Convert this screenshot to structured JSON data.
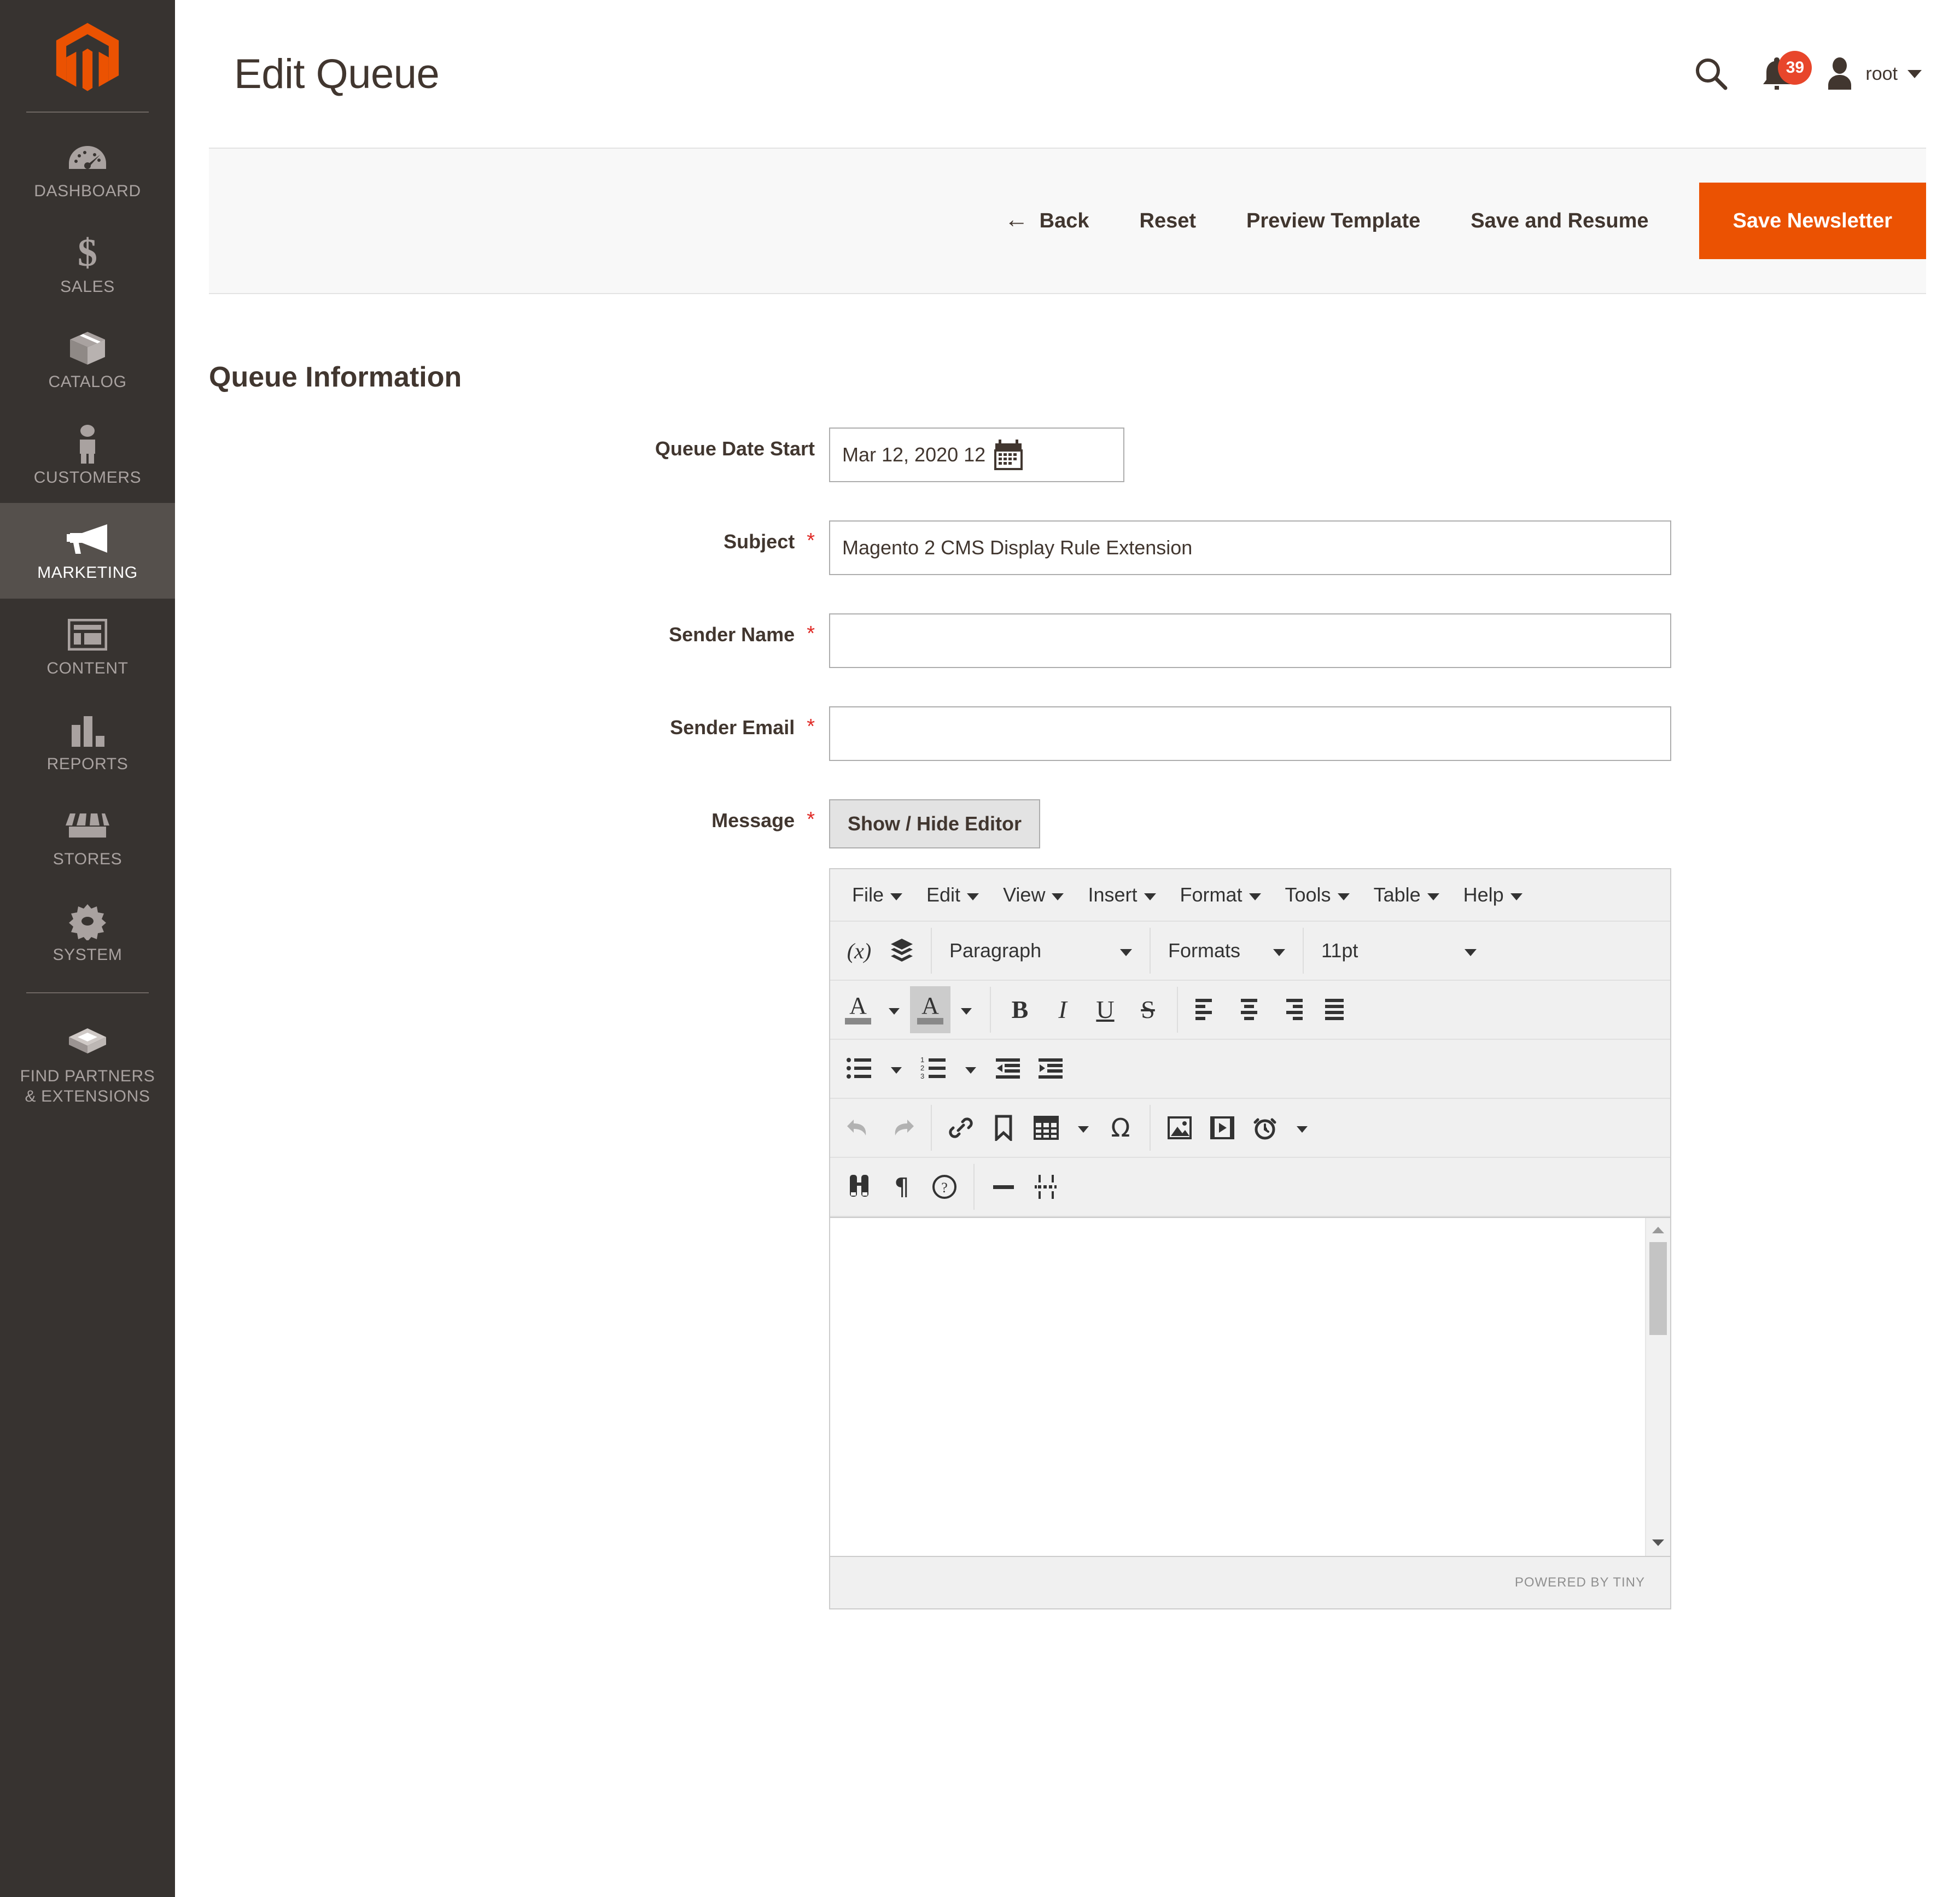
{
  "sidebar": {
    "logo_name": "magento-logo",
    "items": [
      {
        "label": "DASHBOARD",
        "icon": "dashboard-gauge-icon",
        "active": false
      },
      {
        "label": "SALES",
        "icon": "dollar-sign-icon",
        "active": false
      },
      {
        "label": "CATALOG",
        "icon": "box-icon",
        "active": false
      },
      {
        "label": "CUSTOMERS",
        "icon": "person-icon",
        "active": false
      },
      {
        "label": "MARKETING",
        "icon": "megaphone-icon",
        "active": true
      },
      {
        "label": "CONTENT",
        "icon": "layout-window-icon",
        "active": false
      },
      {
        "label": "REPORTS",
        "icon": "bar-chart-icon",
        "active": false
      },
      {
        "label": "STORES",
        "icon": "storefront-icon",
        "active": false
      },
      {
        "label": "SYSTEM",
        "icon": "gear-icon",
        "active": false
      },
      {
        "label": "FIND PARTNERS\n& EXTENSIONS",
        "icon": "extension-box-icon",
        "active": false
      }
    ]
  },
  "header": {
    "title": "Edit Queue",
    "search_icon": "search-icon",
    "notifications_icon": "bell-icon",
    "notifications_count": "39",
    "user_icon": "user-avatar-icon",
    "user_name": "root"
  },
  "actions": {
    "back": "Back",
    "back_arrow": "←",
    "reset": "Reset",
    "preview_template": "Preview Template",
    "save_and_resume": "Save and Resume",
    "save_newsletter": "Save Newsletter",
    "primary_color": "#eb5202"
  },
  "form": {
    "section_title": "Queue Information",
    "queue_date_start": {
      "label": "Queue Date Start",
      "value": "Mar 12, 2020 12",
      "calendar_icon": "calendar-icon",
      "required": false
    },
    "subject": {
      "label": "Subject",
      "value": "Magento 2 CMS Display Rule Extension",
      "placeholder": "",
      "required": true
    },
    "sender_name": {
      "label": "Sender Name",
      "value": "",
      "placeholder": "",
      "required": true
    },
    "sender_email": {
      "label": "Sender Email",
      "value": "",
      "placeholder": "",
      "required": true
    },
    "message": {
      "label": "Message",
      "toggle_editor_label": "Show / Hide Editor",
      "required": true
    },
    "required_marker": "*"
  },
  "editor": {
    "menubar": [
      {
        "label": "File"
      },
      {
        "label": "Edit"
      },
      {
        "label": "View"
      },
      {
        "label": "Insert"
      },
      {
        "label": "Format"
      },
      {
        "label": "Tools"
      },
      {
        "label": "Table"
      },
      {
        "label": "Help"
      }
    ],
    "block_format": "Paragraph",
    "formats_label": "Formats",
    "font_size": "11pt",
    "variable_icon": "insert-variable-icon",
    "widget_icon": "insert-widget-icon",
    "toolbar_icons": [
      "text-color-icon",
      "background-color-icon",
      "bold-icon",
      "italic-icon",
      "underline-icon",
      "strikethrough-icon",
      "align-left-icon",
      "align-center-icon",
      "align-right-icon",
      "align-justify-icon",
      "bullet-list-icon",
      "numbered-list-icon",
      "decrease-indent-icon",
      "increase-indent-icon",
      "undo-icon",
      "redo-icon",
      "insert-link-icon",
      "bookmark-icon",
      "insert-table-icon",
      "special-character-icon",
      "insert-image-icon",
      "insert-media-icon",
      "insert-datetime-icon",
      "search-replace-icon",
      "show-invisible-chars-icon",
      "help-icon",
      "horizontal-rule-icon",
      "page-break-icon"
    ],
    "content": "",
    "scrollbar": "vertical-scrollbar",
    "status_brand": "POWERED BY TINY"
  }
}
